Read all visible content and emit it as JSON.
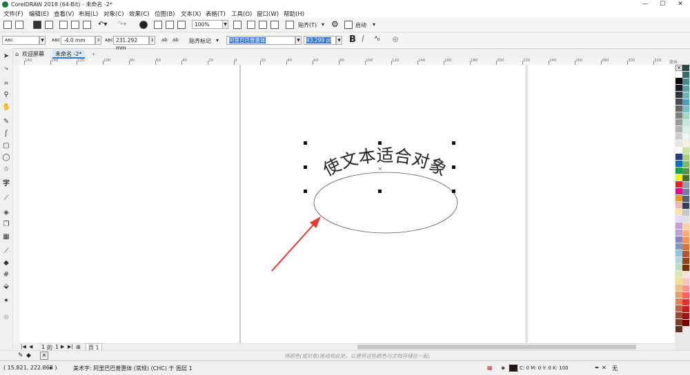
{
  "window": {
    "title": "CorelDRAW 2018 (64-Bit) - 未命名 -2*",
    "minimize": "—",
    "maximize": "☐",
    "close": "✕"
  },
  "menu": [
    "文件(F)",
    "编辑(E)",
    "查看(V)",
    "布局(L)",
    "对象(C)",
    "效果(C)",
    "位图(B)",
    "文本(X)",
    "表格(T)",
    "工具(O)",
    "窗口(W)",
    "帮助(H)"
  ],
  "toolbar1": {
    "zoom_value": "100%",
    "snap_label": "贴齐(T)",
    "launch_label": "启动"
  },
  "property_bar": {
    "offset_value": "-4.0 mm",
    "distance_value": "231.292 mm",
    "snap_marks_label": "贴齐标记",
    "font_name": "阿里巴巴普惠体",
    "font_size": "43.299 pt",
    "bold_label": "B",
    "italic_label": "I"
  },
  "tabs": [
    {
      "label": "欢迎屏幕"
    },
    {
      "label": "未命名 -2*"
    }
  ],
  "ruler": {
    "h_ticks": [
      "160",
      "140",
      "120",
      "100",
      "80",
      "60",
      "40",
      "20",
      "0",
      "20",
      "40",
      "60",
      "80",
      "100",
      "120",
      "140",
      "160",
      "180",
      "200",
      "220",
      "240",
      "260",
      "280",
      "300",
      "320",
      "340"
    ],
    "unit": "毫米"
  },
  "canvas": {
    "fitted_text": "使文本适合对象",
    "text_color": "#222222",
    "arrow_color": "#e8372c"
  },
  "page_nav": {
    "current": "1",
    "of_label": "的",
    "total": "1",
    "page_tab": "页 1"
  },
  "hint": "将颜色(或对象)拖动到此处，以便将这些颜色与文档存储在一起。",
  "status": {
    "coords": "( 15.821, 222.868 )",
    "object_info": "美术字: 阿里巴巴普惠体 (常规) (CHC) 于 图层 1",
    "fill_values": "C: 0 M: 0 Y: 0 K: 100",
    "outline_label": "无"
  },
  "palette_colors": [
    "#ffffff",
    "#000000",
    "#1a1a1a",
    "#333333",
    "#4d4d4d",
    "#666666",
    "#808080",
    "#999999",
    "#b3b3b3",
    "#cccccc",
    "#e6e6e6",
    "#ffffff",
    "#2a3a8a",
    "#0072bc",
    "#00a651",
    "#fff200",
    "#ed1c24",
    "#ec008c",
    "#f7941d",
    "#f5b7b1",
    "#fbe3a6",
    "#e6d8ff",
    "#c7a0d8",
    "#b6a0e0",
    "#8d7fc4",
    "#7a9ac4",
    "#86c7e8",
    "#a8d8e0",
    "#b8e0c0",
    "#d8e8a8",
    "#f0e090",
    "#f0c080",
    "#e8a060",
    "#e08050",
    "#c86040",
    "#a04830",
    "#804028",
    "#603020"
  ],
  "palette_colors2": [
    "#2a4a4a",
    "#3a6a6a",
    "#4a8a8a",
    "#5aa0a0",
    "#6ab4b4",
    "#4aa0c0",
    "#70c0d0",
    "#a0d8c8",
    "#c0e8d8",
    "#d8f0e8",
    "#e8f8f0",
    "#f8f0d8",
    "#c8e0a0",
    "#a8d080",
    "#80b860",
    "#609040",
    "#407030",
    "#90a0b0",
    "#7080a0",
    "#506080",
    "#304060",
    "#c0c8d0",
    "#e0e0e0",
    "#ffd0a0",
    "#ffb070",
    "#ff9050",
    "#e07030",
    "#c05020",
    "#a04010",
    "#803000",
    "#ffe0e0",
    "#ffc0c0",
    "#ff9090",
    "#ff6060",
    "#e03030",
    "#c02020",
    "#a01010",
    "#800000"
  ]
}
